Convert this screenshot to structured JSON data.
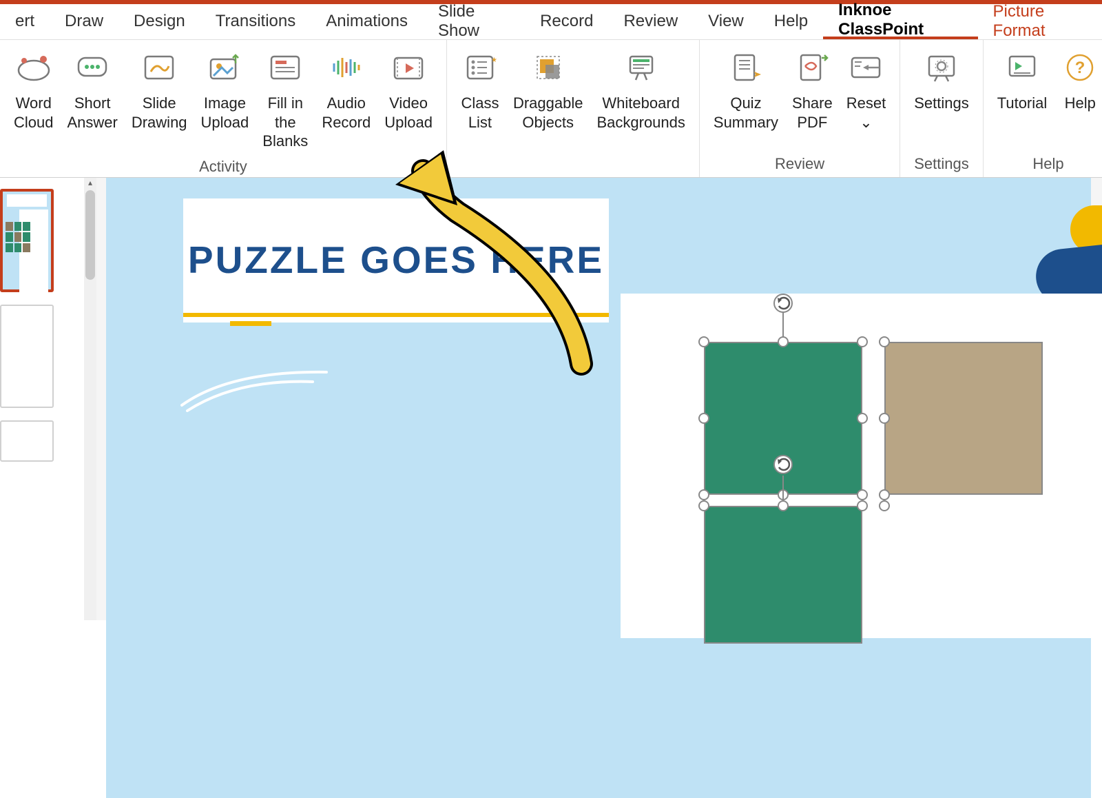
{
  "tabs": {
    "insert": "ert",
    "draw": "Draw",
    "design": "Design",
    "transitions": "Transitions",
    "animations": "Animations",
    "slideshow": "Slide Show",
    "record": "Record",
    "review": "Review",
    "view": "View",
    "help": "Help",
    "classpoint": "Inknoe ClassPoint",
    "picture_format": "Picture Format"
  },
  "ribbon": {
    "activity": {
      "label": "Activity",
      "word_cloud": "Word\nCloud",
      "short_answer": "Short\nAnswer",
      "slide_drawing": "Slide\nDrawing",
      "image_upload": "Image\nUpload",
      "fill_blanks": "Fill in the\nBlanks",
      "audio_record": "Audio\nRecord",
      "video_upload": "Video\nUpload"
    },
    "tools": {
      "class_list": "Class\nList",
      "draggable": "Draggable\nObjects",
      "whiteboard": "Whiteboard\nBackgrounds"
    },
    "review": {
      "label": "Review",
      "quiz_summary": "Quiz\nSummary",
      "share_pdf": "Share\nPDF",
      "reset": "Reset\n⌄"
    },
    "settings": {
      "label": "Settings",
      "settings": "Settings"
    },
    "helpg": {
      "label": "Help",
      "tutorial": "Tutorial",
      "help": "Help"
    }
  },
  "slide": {
    "title": "PUZZLE GOES\nHERE"
  },
  "colors": {
    "accent": "#c43e1c",
    "title": "#1d4f8c",
    "highlight": "#f2b900",
    "canvas": "#bfe2f5",
    "shape": "#2e8c6c"
  }
}
